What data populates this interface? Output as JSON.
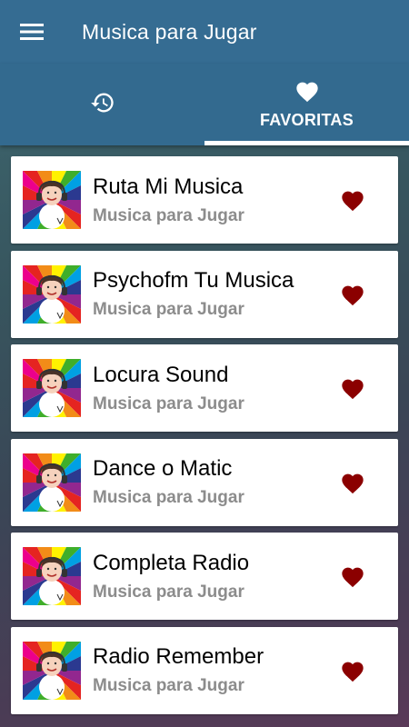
{
  "appbar": {
    "title": "Musica para Jugar",
    "menu_icon": "hamburger-menu-icon"
  },
  "tabs": [
    {
      "icon": "history-icon",
      "label": "",
      "selected": false
    },
    {
      "icon": "heart-icon",
      "label": "FAVORITAS",
      "selected": true
    }
  ],
  "stations": [
    {
      "name": "Ruta Mi Musica",
      "subtitle": "Musica para Jugar",
      "favorite": true
    },
    {
      "name": "Psychofm Tu Musica",
      "subtitle": "Musica para Jugar",
      "favorite": true
    },
    {
      "name": "Locura Sound",
      "subtitle": "Musica para Jugar",
      "favorite": true
    },
    {
      "name": "Dance o Matic",
      "subtitle": "Musica para Jugar",
      "favorite": true
    },
    {
      "name": "Completa Radio",
      "subtitle": "Musica para Jugar",
      "favorite": true
    },
    {
      "name": "Radio Remember",
      "subtitle": "Musica para Jugar",
      "favorite": true
    }
  ],
  "colors": {
    "appbar": "#356c92",
    "tabbar": "#336a8f",
    "heart": "#8b0000",
    "subtitle": "#8c8c8c"
  }
}
